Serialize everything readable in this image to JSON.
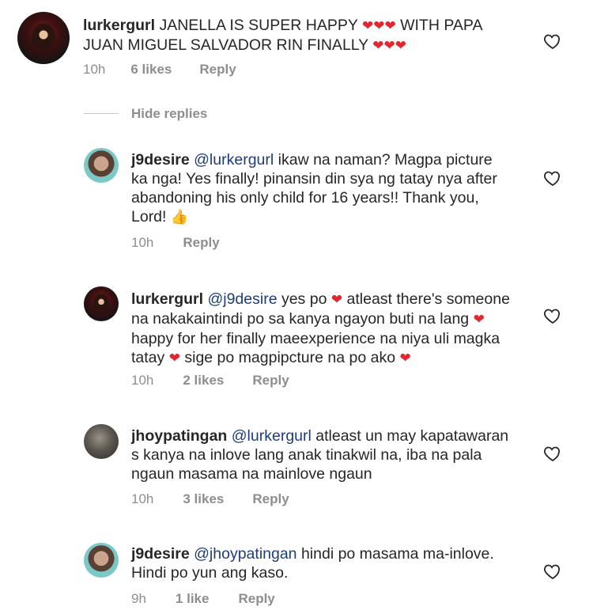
{
  "comments": [
    {
      "username": "lurkergurl",
      "lines": [
        {
          "pre": "",
          "mention": "",
          "text": "JANELLA IS SUPER HAPPY ",
          "hearts": "❤❤❤",
          "post": " WITH PAPA"
        },
        {
          "pre": "",
          "mention": "",
          "text": "JUAN MIGUEL SALVADOR RIN FINALLY ",
          "hearts": "❤❤❤",
          "post": ""
        }
      ],
      "time": "10h",
      "likes": "6 likes",
      "reply": "Reply"
    },
    {
      "username": "j9desire",
      "mention": "@lurkergurl",
      "body": [
        " ikaw na naman? Magpa picture",
        "ka nga! Yes finally! pinansin din sya ng tatay nya after",
        "abandoning his only child for 16 years!! Thank you,",
        "Lord! "
      ],
      "emoji": "👍",
      "time": "10h",
      "likes": "",
      "reply": "Reply"
    },
    {
      "username": "lurkergurl",
      "mention": "@j9desire",
      "body": [
        " yes po ",
        " atleast there's someone",
        "na nakakaintindi po sa kanya ngayon buti na lang ",
        "happy for her finally maeexperience na niya uli magka",
        "tatay ",
        " sige po magpipcture na po ako "
      ],
      "time": "10h",
      "likes": "2 likes",
      "reply": "Reply"
    },
    {
      "username": "jhoypatingan",
      "mention": "@lurkergurl",
      "body": [
        " atleast un may kapatawaran",
        "s kanya na inlove lang anak tinakwil na, iba na pala",
        "ngaun masama na mainlove ngaun"
      ],
      "time": "10h",
      "likes": "3 likes",
      "reply": "Reply"
    },
    {
      "username": "j9desire",
      "mention": "@jhoypatingan",
      "body": [
        " hindi po masama ma-inlove.",
        "Hindi po yun ang kaso."
      ],
      "time": "9h",
      "likes": "1 like",
      "reply": "Reply"
    }
  ],
  "hide_replies": "Hide replies",
  "heart": "❤",
  "icons": {
    "like": "heart-outline-icon"
  }
}
